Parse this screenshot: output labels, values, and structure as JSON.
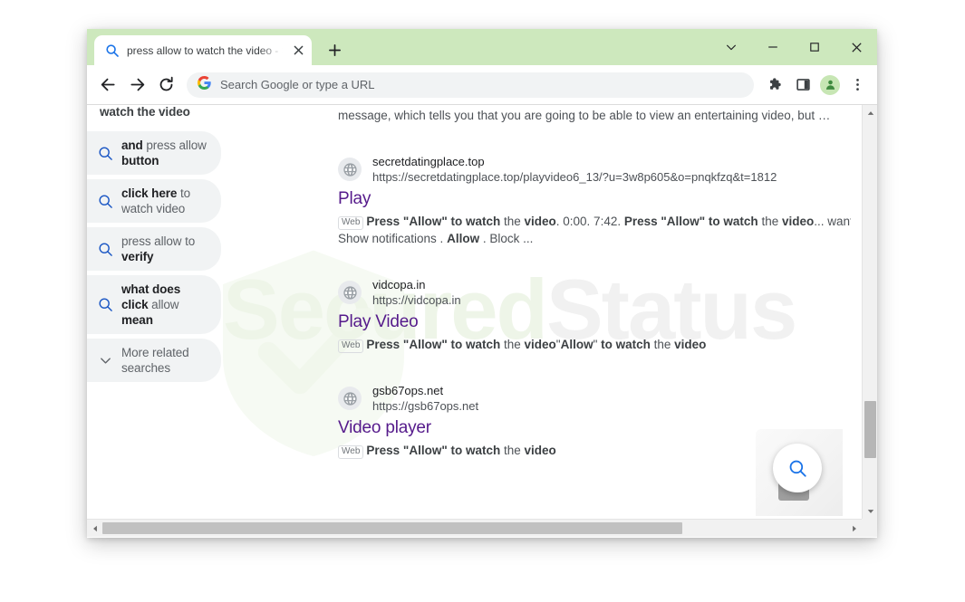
{
  "window": {
    "tab": {
      "title": "press allow to watch the video - S",
      "favicon": "search-icon",
      "close": "✕"
    },
    "new_tab_label": "+",
    "controls": {
      "tab_search": "⌄",
      "minimize": "—",
      "maximize": "□",
      "close": "✕"
    },
    "accent_titlebar": "#cde8bd"
  },
  "toolbar": {
    "back": "←",
    "forward": "→",
    "reload": "↻",
    "omnibox": {
      "icon": "google-g-icon",
      "placeholder": "Search Google or type a URL",
      "value": "Search Google or type a URL"
    },
    "extensions": "puzzle-icon",
    "side_panel": "side-panel-icon",
    "profile": "profile-avatar",
    "menu": "three-dot-menu-icon"
  },
  "watermark": {
    "part_a": "Secured",
    "part_b": "Status",
    "color_a": "#eef5e8",
    "color_b": "#f1f1f1"
  },
  "sidebar": {
    "header_partial": "watch the video",
    "items": [
      {
        "icon": "search-icon",
        "html": "<b>and</b> press allow <b>button</b>"
      },
      {
        "icon": "search-icon",
        "html": "<b>click here</b> to watch video"
      },
      {
        "icon": "search-icon",
        "html": "press allow to <b>verify</b>"
      },
      {
        "icon": "search-icon",
        "html": "<b>what does click</b> allow <b>mean</b>"
      },
      {
        "icon": "chevron-down-icon",
        "html": "More related searches"
      }
    ]
  },
  "main": {
    "snippet_tail": "message, which tells you that you are going to be able to view an entertaining video, but …",
    "results": [
      {
        "favicon": "globe-icon",
        "site": "secretdatingplace.top",
        "url": "https://secretdatingplace.top/playvideo6_13/?u=3w8p605&o=pnqkfzq&t=1812",
        "title": "Play",
        "badge": "Web",
        "desc_html": "<b>Press \"Allow\" to watch</b> the <b>video</b>. 0:00. 7:42. <b>Press \"Allow\" to watch</b> the <b>video</b>... wants to: Show notifications . <b>Allow</b> . Block ..."
      },
      {
        "favicon": "globe-icon",
        "site": "vidcopa.in",
        "url": "https://vidcopa.in",
        "title": "Play Video",
        "badge": "Web",
        "desc_html": "<b>Press \"Allow\" to watch</b> the <b>video</b>\"<b>Allow</b>\" <b>to watch</b> the <b>video</b>"
      },
      {
        "favicon": "globe-icon",
        "site": "gsb67ops.net",
        "url": "https://gsb67ops.net",
        "title": "Video player",
        "badge": "Web",
        "desc_html": "<b>Press \"Allow\" to watch</b> the <b>video</b>"
      }
    ]
  },
  "fab": {
    "icon": "search-icon",
    "color": "#1a73e8"
  }
}
